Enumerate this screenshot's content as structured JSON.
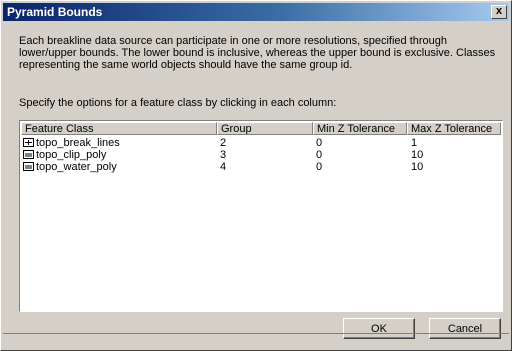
{
  "window": {
    "title": "Pyramid Bounds",
    "close_label": "x"
  },
  "description": "Each breakline data source can participate in one or more resolutions, specified through lower/upper bounds. The lower bound is inclusive, whereas the upper bound is exclusive. Classes representing the same world objects should have the same group id.",
  "prompt": "Specify the options for a feature class by clicking in each column:",
  "table": {
    "columns": [
      "Feature Class",
      "Group",
      "Min Z Tolerance",
      "Max Z Tolerance"
    ],
    "rows": [
      {
        "icon": "polyline-feature-icon",
        "feature_class": "topo_break_lines",
        "group": "2",
        "min_z": "0",
        "max_z": "1"
      },
      {
        "icon": "polygon-feature-icon",
        "feature_class": "topo_clip_poly",
        "group": "3",
        "min_z": "0",
        "max_z": "10"
      },
      {
        "icon": "polygon-feature-icon",
        "feature_class": "topo_water_poly",
        "group": "4",
        "min_z": "0",
        "max_z": "10"
      }
    ]
  },
  "buttons": {
    "ok": "OK",
    "cancel": "Cancel"
  }
}
